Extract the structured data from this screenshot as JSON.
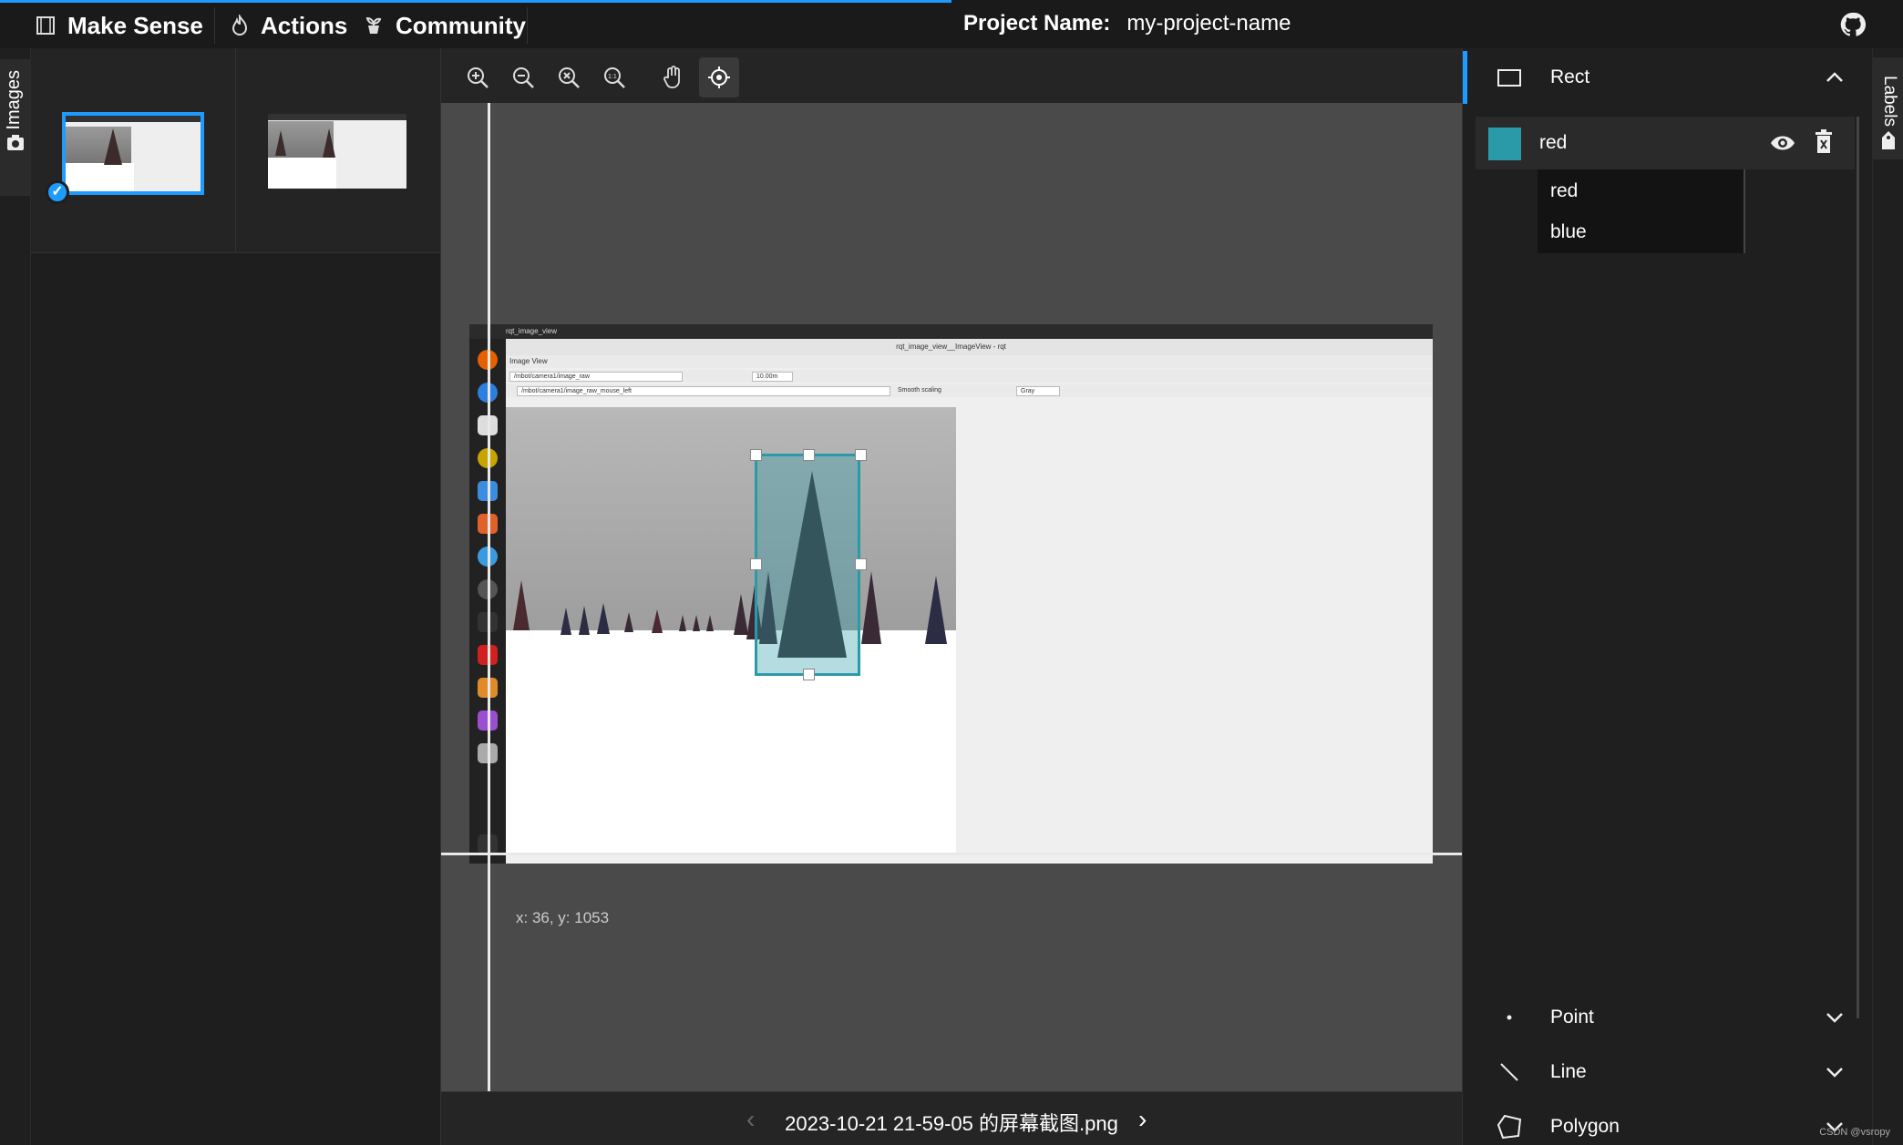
{
  "topbar": {
    "brand": "Make Sense",
    "actions": "Actions",
    "community": "Community",
    "project_label": "Project Name:",
    "project_value": "my-project-name"
  },
  "left_tab": {
    "label": "Images"
  },
  "right_tab": {
    "label": "Labels"
  },
  "editor": {
    "tools": [
      "zoom-in",
      "zoom-out",
      "zoom-fit",
      "zoom-reset",
      "pan",
      "crosshair"
    ],
    "active_tool": "crosshair",
    "cursor_coords": "x: 36, y: 1053",
    "file_name": "2023-10-21 21-59-05 的屏幕截图.png"
  },
  "screenshot_content": {
    "system_bar": "rqt_image_view",
    "window_title": "rqt_image_view__ImageView - rqt",
    "panel_title": "Image View",
    "topic": "/mbot/camera1/image_raw",
    "topic2": "/mbot/camera1/image_raw_mouse_left",
    "zoom_value": "10.00m",
    "smooth_label": "Smooth scaling",
    "color_mode": "Gray"
  },
  "labels_panel": {
    "sections": [
      {
        "name": "Rect",
        "expanded": true
      },
      {
        "name": "Point",
        "expanded": false
      },
      {
        "name": "Line",
        "expanded": false
      },
      {
        "name": "Polygon",
        "expanded": false
      }
    ],
    "active_label": {
      "name": "red",
      "color": "#2a9aa8"
    },
    "dropdown_options": [
      "red",
      "blue"
    ]
  },
  "colors": {
    "accent": "#1e9bff",
    "bbox": "#2a9aa8"
  },
  "watermark": "CSDN @vsropy"
}
